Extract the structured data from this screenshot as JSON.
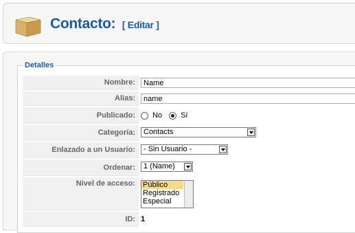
{
  "header": {
    "title": "Contacto:",
    "action_label": "[ Editar ]"
  },
  "details": {
    "legend": "Detalles",
    "fields": {
      "nombre": {
        "label": "Nombre:",
        "value": "Name"
      },
      "alias": {
        "label": "Alias:",
        "value": "name"
      },
      "publicado": {
        "label": "Publicado:",
        "options": [
          "No",
          "Sí"
        ],
        "selected": "Sí"
      },
      "categoria": {
        "label": "Categoría:",
        "value": "Contacts"
      },
      "usuario": {
        "label": "Enlazado a un Usuario:",
        "value": "- Sin Usuario -"
      },
      "ordenar": {
        "label": "Ordenar:",
        "value": "1 (Name)"
      },
      "acceso": {
        "label": "Nivel de acceso:",
        "options": [
          "Público",
          "Registrado",
          "Especial"
        ],
        "selected": "Público"
      },
      "id": {
        "label": "ID:",
        "value": "1"
      }
    }
  }
}
